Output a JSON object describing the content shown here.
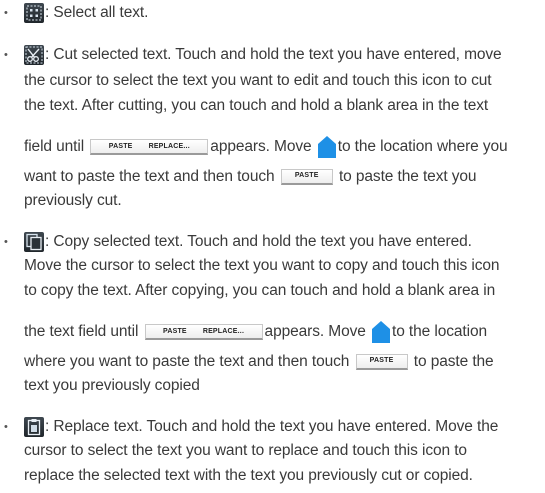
{
  "items": [
    {
      "icon": "select-all-icon",
      "lines": [
        ": Select all text."
      ]
    },
    {
      "icon": "cut-icon",
      "lines": [
        ": Cut selected text. Touch and hold the text you have entered, move",
        "the cursor to select the text you want to edit and touch this icon to cut",
        "the text. After cutting, you can touch and hold a blank area in the text",
        "field until",
        "appears. Move",
        "to the location where you",
        "want to paste the text and then touch",
        "to paste the text you",
        "previously cut."
      ]
    },
    {
      "icon": "copy-icon",
      "lines": [
        ": Copy selected text. Touch and hold the text you have entered.",
        "Move the cursor to select the text you want to copy and touch this icon",
        "to copy the text. After copying, you can touch and hold a blank area in",
        "the text field until",
        "appears. Move",
        "to the location",
        "where you want to paste the text and then touch",
        "to paste the",
        "text you previously copied"
      ]
    },
    {
      "icon": "replace-icon",
      "lines": [
        ": Replace text. Touch and hold the text you have entered. Move the",
        "cursor to select the text you want to replace and touch this icon to",
        "replace the selected text with the text you previously cut or copied."
      ]
    }
  ],
  "buttons": {
    "paste": "PASTE",
    "replace": "REPLACE..."
  },
  "bullet": "•"
}
